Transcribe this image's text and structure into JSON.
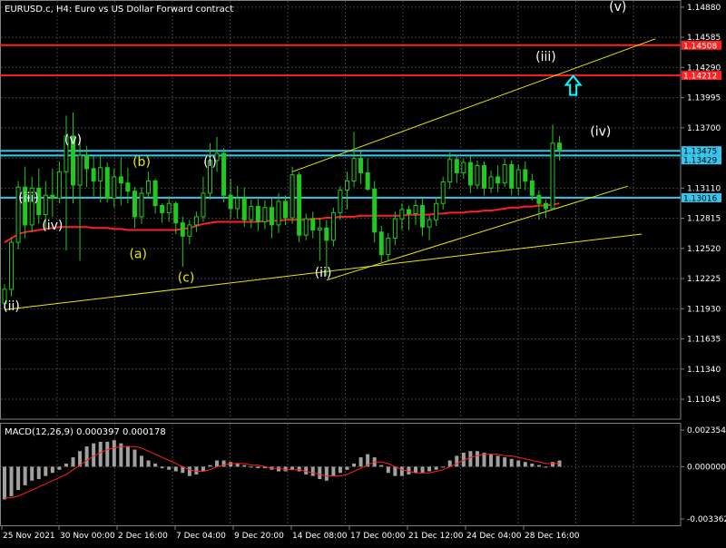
{
  "header": {
    "symbol_title": "EURUSD.c, H4:  Euro vs US Dollar Forward contract",
    "macd_title": "MACD(12,26,9) 0.000397 0.000178"
  },
  "price_axis": {
    "ticks": [
      "1.14880",
      "1.14585",
      "1.14290",
      "1.13995",
      "1.13700",
      "1.13405",
      "1.13110",
      "1.12815",
      "1.12520",
      "1.12225",
      "1.11930",
      "1.11635",
      "1.11340",
      "1.11045"
    ],
    "tick_values": [
      1.1488,
      1.14585,
      1.1429,
      1.13995,
      1.137,
      1.13405,
      1.1311,
      1.12815,
      1.1252,
      1.12225,
      1.1193,
      1.11635,
      1.1134,
      1.11045
    ]
  },
  "macd_axis": {
    "ticks": [
      "0.002354",
      "0.000000",
      "-0.003362"
    ],
    "tick_values": [
      0.002354,
      0,
      -0.003362
    ]
  },
  "time_axis": {
    "labels": [
      "25 Nov 2021",
      "30 Nov 00:00",
      "2 Dec 16:00",
      "7 Dec 04:00",
      "9 Dec 20:00",
      "14 Dec 08:00",
      "17 Dec 00:00",
      "21 Dec 12:00",
      "24 Dec 04:00",
      "28 Dec 16:00"
    ]
  },
  "price_tags": [
    {
      "label": "1.14508",
      "value": 1.14508,
      "line_color": "#ff2020",
      "tag_color": "#ff2020",
      "text_color": "#ffffff"
    },
    {
      "label": "1.14212",
      "value": 1.14212,
      "line_color": "#ff2020",
      "tag_color": "#ff2020",
      "text_color": "#ffffff"
    },
    {
      "label": "1.13475",
      "value": 1.13475,
      "line_color": "#37c6f0",
      "tag_color": "#37c6f0",
      "text_color": "#000000"
    },
    {
      "label": "1.13429",
      "value": 1.13429,
      "line_color": "#37c6f0",
      "tag_color": "#37c6f0",
      "text_color": "#000000"
    },
    {
      "label": "1.13016",
      "value": 1.13016,
      "line_color": "#37c6f0",
      "tag_color": "#37c6f0",
      "text_color": "#000000"
    }
  ],
  "wave_labels": [
    {
      "text": "(v)",
      "color": "#ffffff",
      "bar": 89.5,
      "price": 1.1488
    },
    {
      "text": "(iii)",
      "color": "#ffffff",
      "bar": 79,
      "price": 1.1439
    },
    {
      "text": "(iv)",
      "color": "#ffffff",
      "bar": 87,
      "price": 1.1366
    },
    {
      "text": "(v)",
      "color": "#ffffff",
      "bar": 10,
      "price": 1.1358
    },
    {
      "text": "(b)",
      "color": "#e8e800",
      "bar": 20,
      "price": 1.1336
    },
    {
      "text": "(i)",
      "color": "#ffffff",
      "bar": 30,
      "price": 1.1336
    },
    {
      "text": "(iii)",
      "color": "#ffffff",
      "bar": 3.5,
      "price": 1.1301
    },
    {
      "text": "(iv)",
      "color": "#ffffff",
      "bar": 7,
      "price": 1.1274
    },
    {
      "text": "(a)",
      "color": "#e8e800",
      "bar": 19.5,
      "price": 1.1246
    },
    {
      "text": "(c)",
      "color": "#e8e800",
      "bar": 26.5,
      "price": 1.1223
    },
    {
      "text": "(ii)",
      "color": "#ffffff",
      "bar": 46.5,
      "price": 1.1228
    },
    {
      "text": "(ii)",
      "color": "#ffffff",
      "bar": 1,
      "price": 1.1195
    }
  ],
  "arrow": {
    "name": "up-arrow-icon",
    "color": "#00ffff",
    "bar": 83,
    "price": 1.1411
  },
  "trendlines": [
    {
      "color": "#e8e800",
      "bar1": 0,
      "price1": 1.1192,
      "bar2": 93,
      "price2": 1.1266
    },
    {
      "color": "#e8e800",
      "bar1": 42,
      "price1": 1.1327,
      "bar2": 95,
      "price2": 1.1457
    },
    {
      "color": "#e8e800",
      "bar1": 47,
      "price1": 1.1221,
      "bar2": 91,
      "price2": 1.1313
    }
  ],
  "colors": {
    "background": "#000000",
    "grid": "#3c3c3c",
    "bull_candle": "#22c822",
    "bear_candle": "#22c822",
    "moving_average": "#ff2020",
    "macd_histogram": "#a0a0a0",
    "macd_signal": "#ff2020",
    "axis_text": "#ffffff"
  },
  "chart_data": {
    "type": "candlestick",
    "series": [
      {
        "name": "EURUSD.c, H4",
        "type": "candlestick",
        "ohlc": [
          [
            1.1198,
            1.1217,
            1.1193,
            1.1212
          ],
          [
            1.1212,
            1.1263,
            1.1205,
            1.1258
          ],
          [
            1.1258,
            1.1318,
            1.1251,
            1.1312
          ],
          [
            1.1312,
            1.1332,
            1.1262,
            1.1275
          ],
          [
            1.1275,
            1.1322,
            1.1268,
            1.1311
          ],
          [
            1.1311,
            1.133,
            1.1276,
            1.1285
          ],
          [
            1.1285,
            1.1318,
            1.127,
            1.1304
          ],
          [
            1.1304,
            1.133,
            1.1283,
            1.1301
          ],
          [
            1.1301,
            1.1337,
            1.1296,
            1.1327
          ],
          [
            1.1327,
            1.1382,
            1.125,
            1.1362
          ],
          [
            1.1362,
            1.1385,
            1.1296,
            1.1314
          ],
          [
            1.1314,
            1.1358,
            1.124,
            1.1343
          ],
          [
            1.1343,
            1.1352,
            1.1312,
            1.133
          ],
          [
            1.133,
            1.1342,
            1.1303,
            1.1318
          ],
          [
            1.1318,
            1.1342,
            1.1297,
            1.1331
          ],
          [
            1.1331,
            1.1336,
            1.1297,
            1.1301
          ],
          [
            1.1301,
            1.133,
            1.1292,
            1.1322
          ],
          [
            1.1322,
            1.1341,
            1.1294,
            1.1316
          ],
          [
            1.1316,
            1.1331,
            1.1296,
            1.1308
          ],
          [
            1.1308,
            1.1312,
            1.1272,
            1.1283
          ],
          [
            1.1283,
            1.1312,
            1.1276,
            1.1306
          ],
          [
            1.1306,
            1.1327,
            1.1301,
            1.1318
          ],
          [
            1.1318,
            1.132,
            1.1286,
            1.1294
          ],
          [
            1.1294,
            1.1296,
            1.1277,
            1.1287
          ],
          [
            1.1287,
            1.1303,
            1.1278,
            1.1296
          ],
          [
            1.1296,
            1.1298,
            1.1266,
            1.1277
          ],
          [
            1.1277,
            1.1283,
            1.1234,
            1.1264
          ],
          [
            1.1264,
            1.128,
            1.1256,
            1.1275
          ],
          [
            1.1275,
            1.1288,
            1.1268,
            1.1283
          ],
          [
            1.1283,
            1.1322,
            1.1278,
            1.1306
          ],
          [
            1.1306,
            1.1355,
            1.13,
            1.1338
          ],
          [
            1.1338,
            1.1361,
            1.1327,
            1.1345
          ],
          [
            1.1345,
            1.135,
            1.1297,
            1.1304
          ],
          [
            1.1304,
            1.132,
            1.1281,
            1.1291
          ],
          [
            1.1291,
            1.1313,
            1.1281,
            1.1301
          ],
          [
            1.1301,
            1.1312,
            1.1273,
            1.128
          ],
          [
            1.128,
            1.13,
            1.1272,
            1.1293
          ],
          [
            1.1293,
            1.1301,
            1.1269,
            1.1278
          ],
          [
            1.1278,
            1.1299,
            1.1271,
            1.1292
          ],
          [
            1.1292,
            1.1302,
            1.1262,
            1.1275
          ],
          [
            1.1275,
            1.1306,
            1.1267,
            1.1298
          ],
          [
            1.1298,
            1.1304,
            1.1275,
            1.1282
          ],
          [
            1.1282,
            1.1332,
            1.1276,
            1.1324
          ],
          [
            1.1324,
            1.1327,
            1.1258,
            1.1265
          ],
          [
            1.1265,
            1.1286,
            1.126,
            1.1281
          ],
          [
            1.1281,
            1.1288,
            1.1262,
            1.127
          ],
          [
            1.127,
            1.1282,
            1.124,
            1.1272
          ],
          [
            1.1272,
            1.128,
            1.1225,
            1.126
          ],
          [
            1.126,
            1.1292,
            1.1254,
            1.1287
          ],
          [
            1.1287,
            1.1313,
            1.128,
            1.1309
          ],
          [
            1.1309,
            1.1327,
            1.129,
            1.1318
          ],
          [
            1.1318,
            1.1366,
            1.1312,
            1.134
          ],
          [
            1.134,
            1.1347,
            1.1315,
            1.1326
          ],
          [
            1.1326,
            1.134,
            1.1308,
            1.131
          ],
          [
            1.131,
            1.1318,
            1.1258,
            1.1268
          ],
          [
            1.1268,
            1.1274,
            1.1237,
            1.1246
          ],
          [
            1.1246,
            1.1267,
            1.124,
            1.1262
          ],
          [
            1.1262,
            1.1288,
            1.1255,
            1.1281
          ],
          [
            1.1281,
            1.1296,
            1.127,
            1.129
          ],
          [
            1.129,
            1.1294,
            1.127,
            1.1286
          ],
          [
            1.1286,
            1.13,
            1.1275,
            1.1294
          ],
          [
            1.1294,
            1.1301,
            1.1264,
            1.1273
          ],
          [
            1.1273,
            1.1284,
            1.126,
            1.128
          ],
          [
            1.128,
            1.1302,
            1.1274,
            1.1296
          ],
          [
            1.1296,
            1.1322,
            1.129,
            1.1317
          ],
          [
            1.1317,
            1.1346,
            1.131,
            1.1339
          ],
          [
            1.1339,
            1.1343,
            1.1316,
            1.1326
          ],
          [
            1.1326,
            1.134,
            1.132,
            1.1336
          ],
          [
            1.1336,
            1.1342,
            1.1306,
            1.1314
          ],
          [
            1.1314,
            1.1338,
            1.131,
            1.1333
          ],
          [
            1.1333,
            1.1337,
            1.1304,
            1.1311
          ],
          [
            1.1311,
            1.1328,
            1.1306,
            1.1322
          ],
          [
            1.1322,
            1.1333,
            1.1307,
            1.1316
          ],
          [
            1.1316,
            1.134,
            1.1312,
            1.1334
          ],
          [
            1.1334,
            1.1338,
            1.1304,
            1.1311
          ],
          [
            1.1311,
            1.1334,
            1.1304,
            1.1329
          ],
          [
            1.1329,
            1.1337,
            1.1309,
            1.1318
          ],
          [
            1.1318,
            1.1325,
            1.1299,
            1.1304
          ],
          [
            1.1304,
            1.1309,
            1.128,
            1.1296
          ],
          [
            1.1296,
            1.13,
            1.1282,
            1.1291
          ],
          [
            1.1291,
            1.1373,
            1.129,
            1.1355
          ],
          [
            1.1355,
            1.1362,
            1.1338,
            1.1349
          ]
        ]
      },
      {
        "name": "Moving average",
        "type": "line",
        "values": [
          1.1258,
          1.1262,
          1.1266,
          1.1268,
          1.1269,
          1.127,
          1.1271,
          1.1272,
          1.1273,
          1.1273,
          1.1273,
          1.1273,
          1.1273,
          1.1272,
          1.1272,
          1.1272,
          1.1271,
          1.1271,
          1.127,
          1.127,
          1.127,
          1.127,
          1.127,
          1.127,
          1.127,
          1.127,
          1.1271,
          1.1272,
          1.1274,
          1.1276,
          1.1277,
          1.1278,
          1.1278,
          1.1278,
          1.1278,
          1.1278,
          1.1278,
          1.1278,
          1.1279,
          1.1279,
          1.1279,
          1.128,
          1.128,
          1.128,
          1.128,
          1.1281,
          1.1281,
          1.1282,
          1.1282,
          1.1283,
          1.1283,
          1.1283,
          1.1284,
          1.1284,
          1.1284,
          1.1284,
          1.1284,
          1.1284,
          1.1284,
          1.1285,
          1.1285,
          1.1285,
          1.1285,
          1.1286,
          1.1286,
          1.1287,
          1.1287,
          1.1287,
          1.1288,
          1.1288,
          1.1289,
          1.1289,
          1.129,
          1.1291,
          1.1292,
          1.1292,
          1.1293,
          1.1293,
          1.1294,
          1.1294,
          1.1295,
          1.1296
        ]
      },
      {
        "name": "MACD histogram",
        "type": "bar",
        "values": [
          -0.0021,
          -0.0019,
          -0.0015,
          -0.0012,
          -0.0009,
          -0.0008,
          -0.0006,
          -0.0004,
          -0.0002,
          0.0002,
          0.0006,
          0.001,
          0.0013,
          0.0015,
          0.0016,
          0.0016,
          0.0017,
          0.0015,
          0.0013,
          0.0011,
          0.0007,
          0.0004,
          0.0002,
          -0.0001,
          -0.0002,
          -0.0003,
          -0.0004,
          -0.0006,
          -0.0005,
          -0.0003,
          0.0001,
          0.0004,
          0.0004,
          0.0003,
          0.0002,
          0.0001,
          0.0,
          -0.0001,
          -0.0001,
          -0.0002,
          -0.0003,
          -0.0003,
          -0.0002,
          -0.0003,
          -0.0005,
          -0.0006,
          -0.0008,
          -0.0009,
          -0.0006,
          -0.0004,
          -0.0002,
          0.0002,
          0.0006,
          0.0008,
          0.0006,
          0.0001,
          -0.0004,
          -0.0006,
          -0.0006,
          -0.0005,
          -0.0004,
          -0.0004,
          -0.0003,
          -0.0002,
          0.0,
          0.0004,
          0.0007,
          0.0009,
          0.001,
          0.001,
          0.0009,
          0.0008,
          0.0007,
          0.0006,
          0.0005,
          0.0004,
          0.0003,
          0.0002,
          0.0001,
          0.0,
          0.0003,
          0.0004
        ]
      },
      {
        "name": "MACD signal",
        "type": "line",
        "values": [
          -0.002,
          -0.002,
          -0.0019,
          -0.0017,
          -0.0015,
          -0.0013,
          -0.0011,
          -0.0009,
          -0.0007,
          -0.0005,
          -0.0002,
          0.0001,
          0.0004,
          0.0007,
          0.0009,
          0.0011,
          0.0012,
          0.0013,
          0.0013,
          0.0013,
          0.0012,
          0.001,
          0.0008,
          0.0006,
          0.0004,
          0.0002,
          0.0,
          -0.0002,
          -0.0003,
          -0.0003,
          -0.0002,
          0.0,
          0.0001,
          0.0002,
          0.0002,
          0.0002,
          0.0001,
          0.0001,
          0.0,
          -0.0001,
          -0.0001,
          -0.0002,
          -0.0002,
          -0.0002,
          -0.0003,
          -0.0004,
          -0.0005,
          -0.0006,
          -0.0006,
          -0.0006,
          -0.0005,
          -0.0003,
          -0.0001,
          0.0001,
          0.0003,
          0.0003,
          0.0002,
          0.0,
          -0.0002,
          -0.0003,
          -0.0004,
          -0.0004,
          -0.0004,
          -0.0003,
          -0.0002,
          0.0,
          0.0002,
          0.0004,
          0.0006,
          0.0007,
          0.0008,
          0.0008,
          0.0008,
          0.0007,
          0.0007,
          0.0006,
          0.0005,
          0.0004,
          0.0003,
          0.0002,
          0.0002,
          0.0002
        ]
      }
    ],
    "xlabel": "",
    "ylabel": "",
    "ylim": [
      1.1085,
      1.1495
    ],
    "macd_ylim": [
      -0.003362,
      0.002354
    ],
    "grid": true,
    "legend": "none"
  }
}
